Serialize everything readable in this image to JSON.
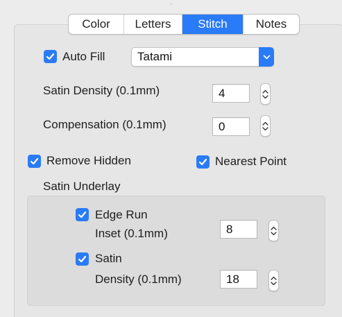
{
  "tabs": {
    "color": "Color",
    "letters": "Letters",
    "stitch": "Stitch",
    "notes": "Notes",
    "active": "Stitch"
  },
  "auto_fill": {
    "label": "Auto Fill",
    "checked": true,
    "fill_type": "Tatami"
  },
  "satin_density": {
    "label": "Satin Density (0.1mm)",
    "value": "4"
  },
  "compensation": {
    "label": "Compensation (0.1mm)",
    "value": "0"
  },
  "remove_hidden": {
    "label": "Remove Hidden",
    "checked": true
  },
  "nearest_point": {
    "label": "Nearest Point",
    "checked": true
  },
  "satin_underlay": {
    "title": "Satin Underlay",
    "edge_run": {
      "label": "Edge Run",
      "checked": true,
      "sub_label": "Inset (0.1mm)",
      "value": "8"
    },
    "satin": {
      "label": "Satin",
      "checked": true,
      "sub_label": "Density (0.1mm)",
      "value": "18"
    }
  },
  "colors": {
    "accent": "#2a7bf7"
  }
}
